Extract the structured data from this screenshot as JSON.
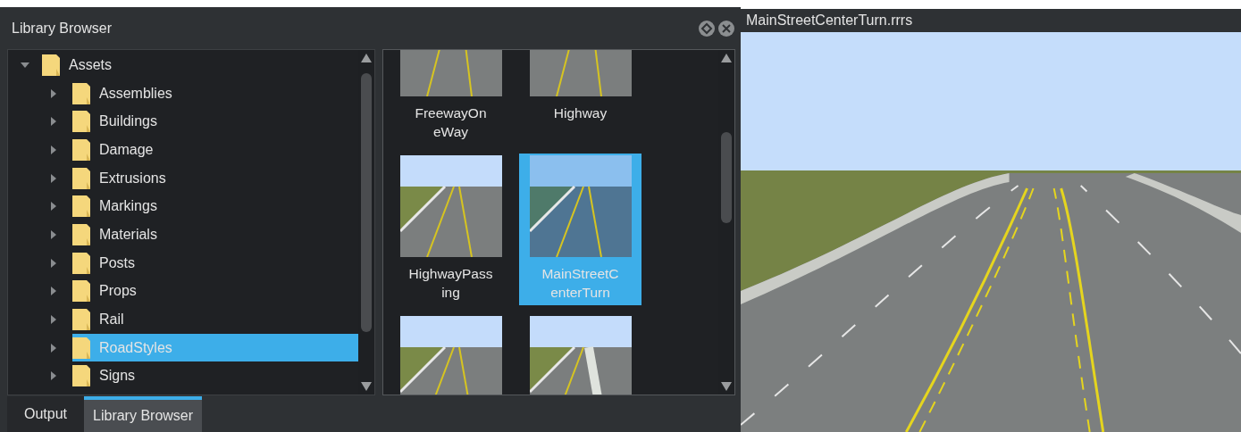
{
  "library_panel": {
    "title": "Library Browser",
    "tree": [
      {
        "label": "Assets",
        "expanded": true,
        "selected": false,
        "children": [
          {
            "label": "Assemblies",
            "expanded": false,
            "selected": false
          },
          {
            "label": "Buildings",
            "expanded": false,
            "selected": false
          },
          {
            "label": "Damage",
            "expanded": false,
            "selected": false
          },
          {
            "label": "Extrusions",
            "expanded": false,
            "selected": false
          },
          {
            "label": "Markings",
            "expanded": false,
            "selected": false
          },
          {
            "label": "Materials",
            "expanded": false,
            "selected": false
          },
          {
            "label": "Posts",
            "expanded": false,
            "selected": false
          },
          {
            "label": "Props",
            "expanded": false,
            "selected": false
          },
          {
            "label": "Rail",
            "expanded": false,
            "selected": false
          },
          {
            "label": "RoadStyles",
            "expanded": false,
            "selected": true
          },
          {
            "label": "Signs",
            "expanded": false,
            "selected": false
          }
        ]
      }
    ],
    "thumbnails": [
      {
        "lines": [
          "FreewayOn",
          "eWay"
        ],
        "selected": false,
        "kind": "freeway"
      },
      {
        "lines": [
          "Highway"
        ],
        "selected": false,
        "kind": "highway"
      },
      {
        "lines": [
          "HighwayPass",
          "ing"
        ],
        "selected": false,
        "kind": "passing"
      },
      {
        "lines": [
          "MainStreetC",
          "enterTurn"
        ],
        "selected": true,
        "kind": "mainstreet"
      },
      {
        "selected": false,
        "kind": "divided"
      },
      {
        "selected": false,
        "kind": "median"
      }
    ],
    "tabs": [
      {
        "label": "Output",
        "selected": false
      },
      {
        "label": "Library Browser",
        "selected": true
      }
    ]
  },
  "viewport": {
    "title": "MainStreetCenterTurn.rrrs"
  }
}
